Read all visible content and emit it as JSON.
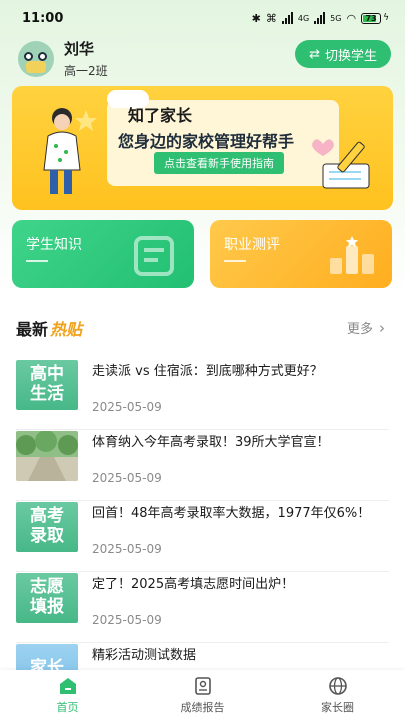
{
  "status_bar": {
    "time": "11:00",
    "network_a": "4G",
    "network_b": "5G",
    "battery": "73"
  },
  "profile": {
    "name": "刘华",
    "class": "高一2班",
    "switch_label": "切换学生"
  },
  "banner": {
    "brand": "知了家长",
    "slogan": "您身边的家校管理好帮手",
    "button_label": "点击查看新手使用指南"
  },
  "quick_cards": [
    {
      "label": "学生知识",
      "color": "#22bf72"
    },
    {
      "label": "职业测评",
      "color": "#ffae1f"
    }
  ],
  "section": {
    "title_a": "最新",
    "title_b": "热贴",
    "more_label": "更多"
  },
  "news": [
    {
      "title": "走读派 vs 住宿派：到底哪种方式更好？",
      "date": "2025-05-09",
      "thumb_line1": "高中",
      "thumb_line2": "生活"
    },
    {
      "title": "体育纳入今年高考录取！39所大学官宣！",
      "date": "2025-05-09",
      "thumb_line1": "",
      "thumb_line2": ""
    },
    {
      "title": "回首！48年高考录取率大数据，1977年仅6%！",
      "date": "2025-05-09",
      "thumb_line1": "高考",
      "thumb_line2": "录取"
    },
    {
      "title": "定了！2025高考填志愿时间出炉！",
      "date": "2025-05-09",
      "thumb_line1": "志愿",
      "thumb_line2": "填报"
    },
    {
      "title": "精彩活动测试数据",
      "date": "",
      "thumb_line1": "家长",
      "thumb_line2": ""
    }
  ],
  "bottom_nav": [
    {
      "label": "首页",
      "icon": "home-icon",
      "active": true
    },
    {
      "label": "成绩报告",
      "icon": "report-icon",
      "active": false
    },
    {
      "label": "家长圈",
      "icon": "globe-icon",
      "active": false
    }
  ],
  "colors": {
    "accent": "#2fbf72",
    "highlight": "#f0a21b",
    "banner": "#ffc21f"
  }
}
